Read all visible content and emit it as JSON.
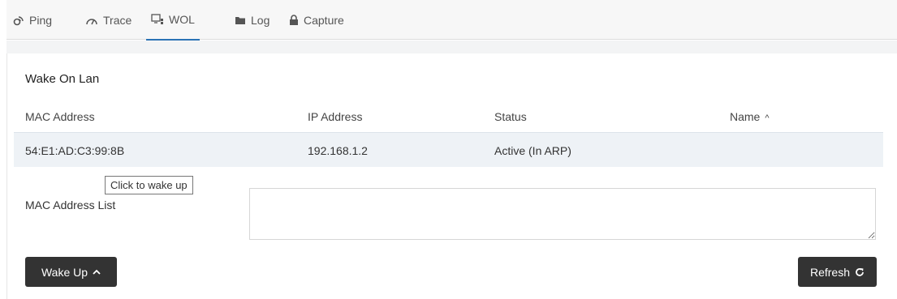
{
  "tabs": [
    {
      "label": "Ping",
      "icon": "ping-icon"
    },
    {
      "label": "Trace",
      "icon": "gauge-icon"
    },
    {
      "label": "WOL",
      "icon": "monitor-network-icon"
    },
    {
      "label": "Log",
      "icon": "folder-icon"
    },
    {
      "label": "Capture",
      "icon": "lock-icon"
    }
  ],
  "active_tab": "WOL",
  "panel": {
    "title": "Wake On Lan"
  },
  "table": {
    "headers": {
      "mac": "MAC Address",
      "ip": "IP Address",
      "status": "Status",
      "name": "Name"
    },
    "sort_indicator": "^",
    "rows": [
      {
        "mac": "54:E1:AD:C3:99:8B",
        "ip": "192.168.1.2",
        "status": "Active (In ARP)",
        "name": ""
      }
    ]
  },
  "tooltip": "Click to wake up",
  "mac_list": {
    "label": "MAC Address List",
    "value": ""
  },
  "buttons": {
    "wake_up": "Wake Up",
    "refresh": "Refresh"
  },
  "colors": {
    "accent": "#2b73b6",
    "button_bg": "#333333",
    "row_highlight": "#eef2f6"
  }
}
